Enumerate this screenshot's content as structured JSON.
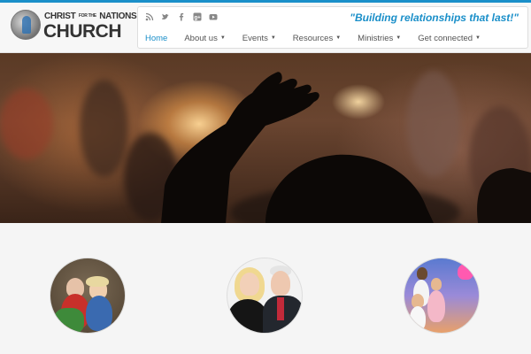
{
  "header": {
    "logo": {
      "line1_pre": "CHRIST",
      "line1_mid": "FOR THE",
      "line1_post": "NATIONS",
      "line2": "CHURCH"
    },
    "tagline": "\"Building relationships that last!\"",
    "social_icons": [
      "rss-icon",
      "twitter-icon",
      "facebook-icon",
      "google-plus-icon",
      "youtube-icon"
    ],
    "menu": [
      {
        "label": "Home",
        "active": true,
        "dropdown": false
      },
      {
        "label": "About us",
        "dropdown": true
      },
      {
        "label": "Events",
        "dropdown": true
      },
      {
        "label": "Resources",
        "dropdown": true
      },
      {
        "label": "Ministries",
        "dropdown": true
      },
      {
        "label": "Get connected",
        "dropdown": true
      }
    ]
  },
  "colors": {
    "accent": "#1a8fc9",
    "text": "#555555"
  },
  "hero": {
    "image": "worship-crowd-raised-hand"
  },
  "featured": [
    {
      "image": "couple-with-plants-portrait"
    },
    {
      "image": "couple-formal-portrait"
    },
    {
      "image": "children-sky-portrait"
    }
  ]
}
